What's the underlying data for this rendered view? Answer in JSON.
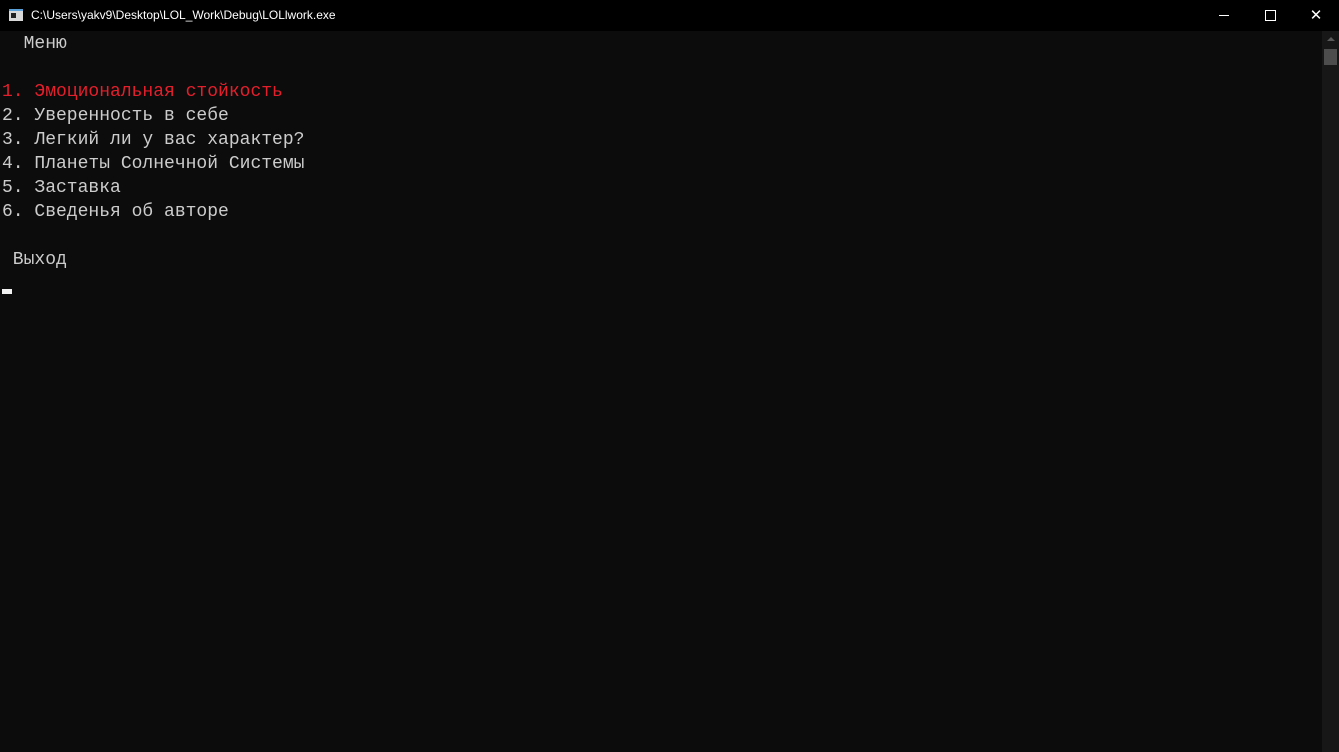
{
  "window": {
    "title": "C:\\Users\\yakv9\\Desktop\\LOL_Work\\Debug\\LOLlwork.exe",
    "icon": "console-app-icon",
    "controls": {
      "minimize_icon": "minimize-icon",
      "maximize_icon": "maximize-icon",
      "close_glyph": "✕"
    }
  },
  "console": {
    "menu_title": "  Меню",
    "items": [
      {
        "label": "1. Эмоциональная стойкость",
        "selected": true
      },
      {
        "label": "2. Уверенность в себе",
        "selected": false
      },
      {
        "label": "3. Легкий ли у вас характер?",
        "selected": false
      },
      {
        "label": "4. Планеты Солнечной Системы",
        "selected": false
      },
      {
        "label": "5. Заставка",
        "selected": false
      },
      {
        "label": "6. Сведенья об авторе",
        "selected": false
      }
    ],
    "exit_label": " Выход"
  },
  "colors": {
    "background": "#0c0c0c",
    "text": "#cccccc",
    "selected": "#e41f2c",
    "titlebar": "#000000"
  }
}
